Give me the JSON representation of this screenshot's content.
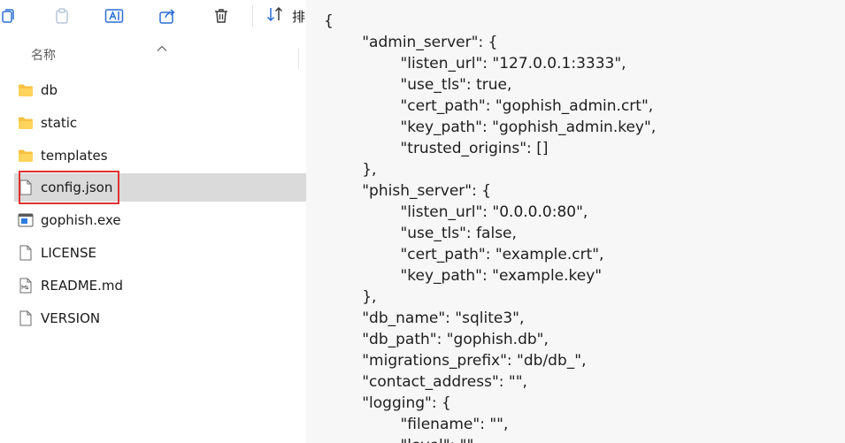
{
  "toolbar": {
    "sort_label": "排",
    "buttons": [
      "copy-icon",
      "paste-icon",
      "rename-icon",
      "share-icon",
      "delete-icon"
    ]
  },
  "column_header": {
    "name_label": "名称"
  },
  "files": [
    {
      "name": "db",
      "icon": "folder-icon",
      "selected": false
    },
    {
      "name": "static",
      "icon": "folder-icon",
      "selected": false
    },
    {
      "name": "templates",
      "icon": "folder-icon",
      "selected": false
    },
    {
      "name": "config.json",
      "icon": "document-icon",
      "selected": true,
      "highlighted": true
    },
    {
      "name": "gophish.exe",
      "icon": "executable-icon",
      "selected": false
    },
    {
      "name": "LICENSE",
      "icon": "document-icon",
      "selected": false
    },
    {
      "name": "README.md",
      "icon": "markdown-icon",
      "selected": false
    },
    {
      "name": "VERSION",
      "icon": "document-icon",
      "selected": false
    }
  ],
  "colors": {
    "highlight_border": "#e03131",
    "selection": "#dadada",
    "editor_bg": "#f7f7f7",
    "folder": "#f6c244"
  },
  "editor": {
    "lines": [
      "{",
      "        \"admin_server\": {",
      "                \"listen_url\": \"127.0.0.1:3333\",",
      "                \"use_tls\": true,",
      "                \"cert_path\": \"gophish_admin.crt\",",
      "                \"key_path\": \"gophish_admin.key\",",
      "                \"trusted_origins\": []",
      "        },",
      "        \"phish_server\": {",
      "                \"listen_url\": \"0.0.0.0:80\",",
      "                \"use_tls\": false,",
      "                \"cert_path\": \"example.crt\",",
      "                \"key_path\": \"example.key\"",
      "        },",
      "        \"db_name\": \"sqlite3\",",
      "        \"db_path\": \"gophish.db\",",
      "        \"migrations_prefix\": \"db/db_\",",
      "        \"contact_address\": \"\",",
      "        \"logging\": {",
      "                \"filename\": \"\",",
      "                \"level\": \"\""
    ]
  }
}
